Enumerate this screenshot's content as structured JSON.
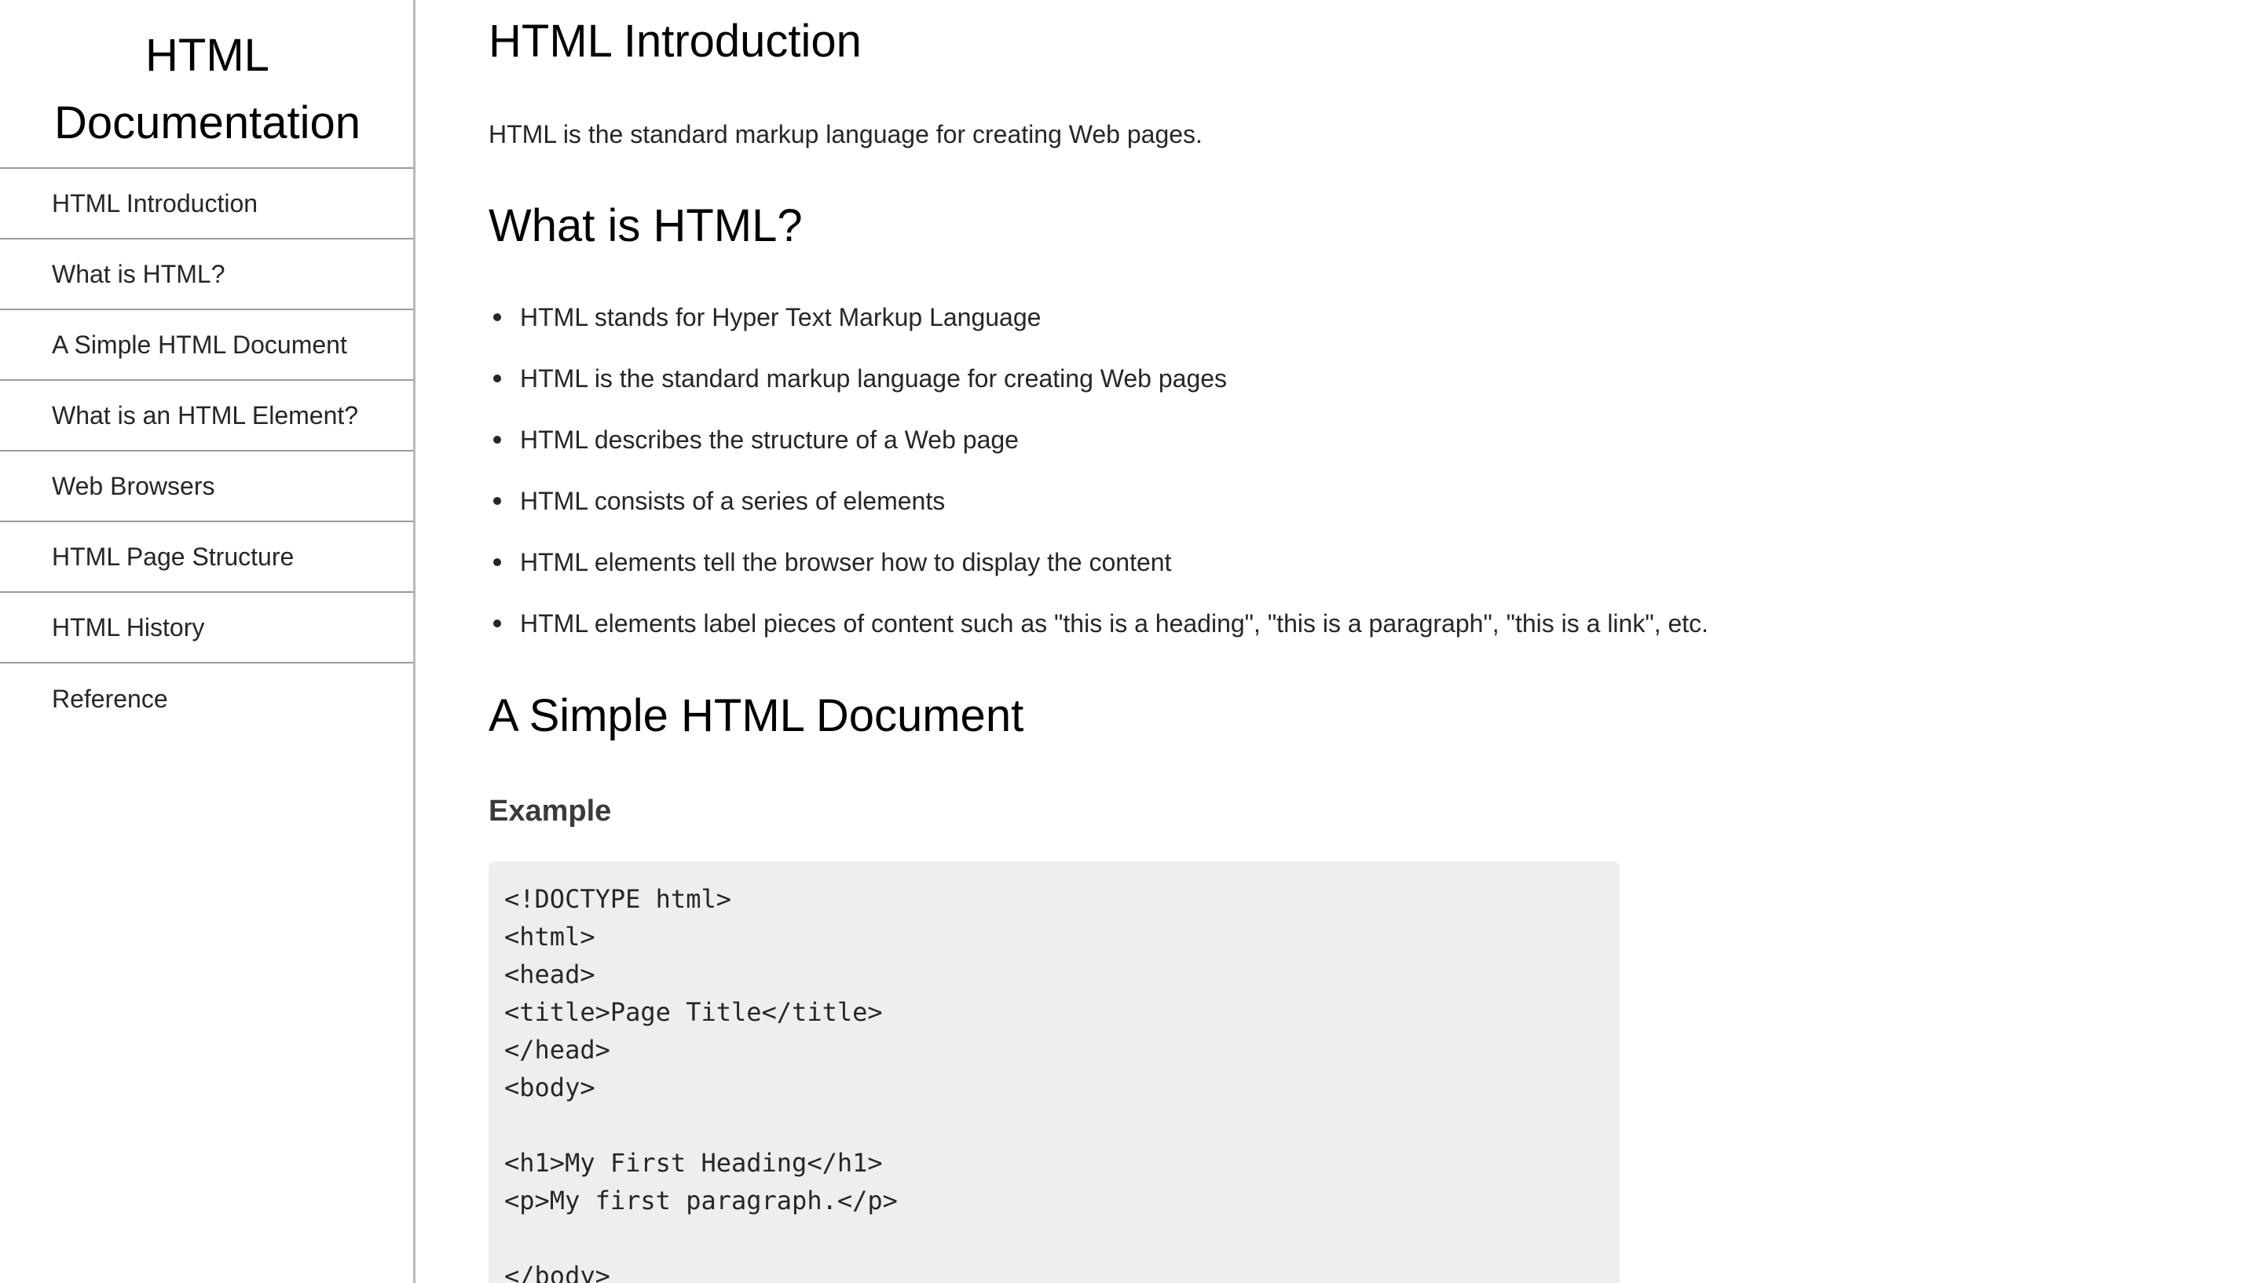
{
  "sidebar": {
    "title_line1": "HTML",
    "title_line2": "Documentation",
    "items": [
      {
        "label": "HTML Introduction"
      },
      {
        "label": "What is HTML?"
      },
      {
        "label": "A Simple HTML Document"
      },
      {
        "label": "What is an HTML Element?"
      },
      {
        "label": "Web Browsers"
      },
      {
        "label": "HTML Page Structure"
      },
      {
        "label": "HTML History"
      },
      {
        "label": "Reference"
      }
    ]
  },
  "main": {
    "intro_heading": "HTML Introduction",
    "intro_text": "HTML is the standard markup language for creating Web pages.",
    "what_heading": "What is HTML?",
    "what_bullets": [
      "HTML stands for Hyper Text Markup Language",
      "HTML is the standard markup language for creating Web pages",
      "HTML describes the structure of a Web page",
      "HTML consists of a series of elements",
      "HTML elements tell the browser how to display the content",
      "HTML elements label pieces of content such as \"this is a heading\", \"this is a paragraph\", \"this is a link\", etc."
    ],
    "simple_heading": "A Simple HTML Document",
    "example_label": "Example",
    "code_lines": [
      "<!DOCTYPE html>",
      "<html>",
      "<head>",
      "<title>Page Title</title>",
      "</head>",
      "<body>",
      "",
      "<h1>My First Heading</h1>",
      "<p>My first paragraph.</p>",
      "",
      "</body>"
    ]
  },
  "colors": {
    "code_background": "#eeeeee",
    "divider": "#9c9c9c",
    "text": "#262626"
  }
}
